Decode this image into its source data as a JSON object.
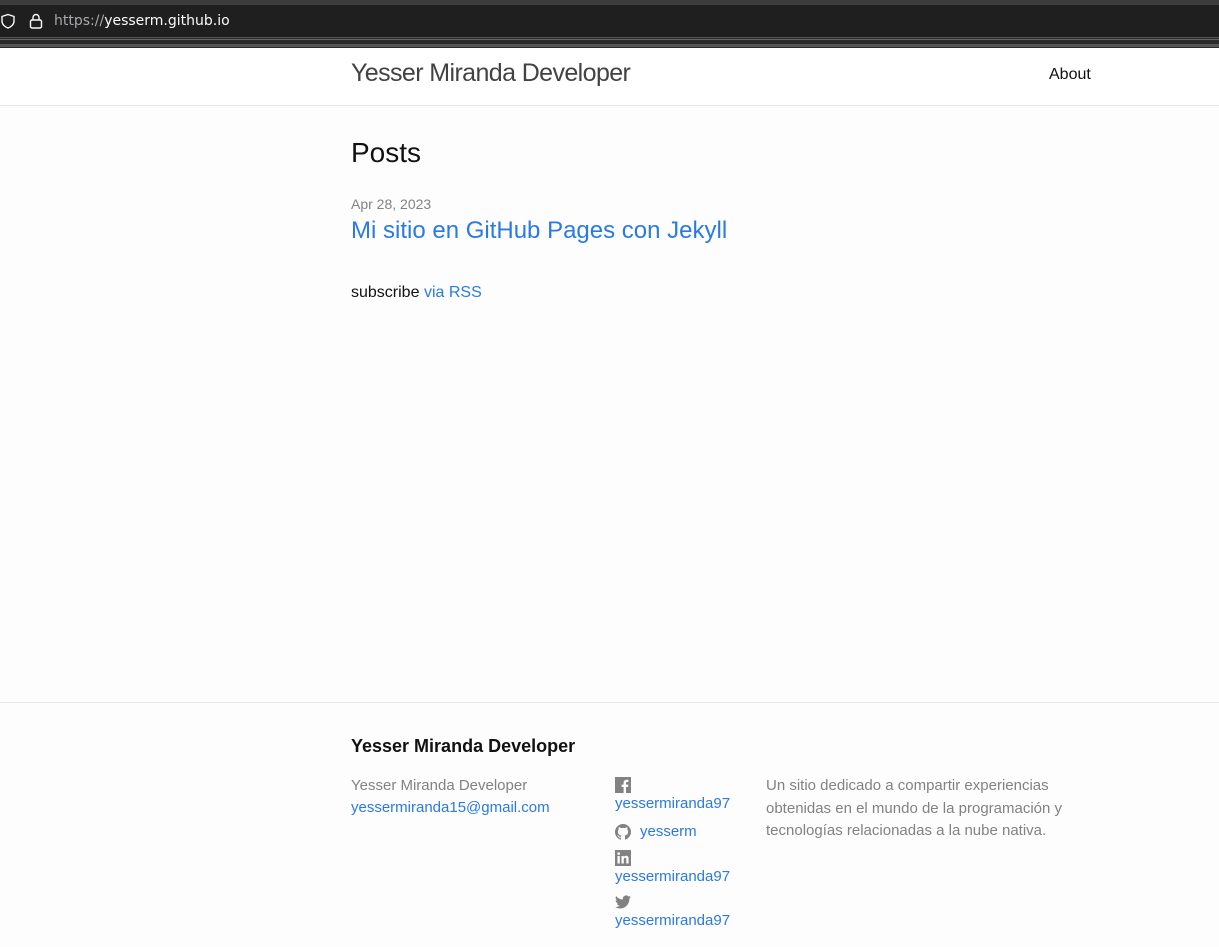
{
  "browser": {
    "url_scheme": "https://",
    "url_host": "yesserm.github.io"
  },
  "header": {
    "site_title": "Yesser Miranda Developer",
    "nav": [
      {
        "label": "About"
      }
    ]
  },
  "main": {
    "heading": "Posts",
    "posts": [
      {
        "date": "Apr 28, 2023",
        "title": "Mi sitio en GitHub Pages con Jekyll"
      }
    ],
    "subscribe_text": "subscribe",
    "rss_link": "via RSS"
  },
  "footer": {
    "heading": "Yesser Miranda Developer",
    "name": "Yesser Miranda Developer",
    "email": "yessermiranda15@gmail.com",
    "social": {
      "facebook": {
        "icon": "facebook-icon",
        "handle": "yessermiranda97"
      },
      "github": {
        "icon": "github-icon",
        "handle": "yesserm"
      },
      "linkedin": {
        "icon": "linkedin-icon",
        "handle": "yessermiranda97"
      },
      "twitter": {
        "icon": "twitter-icon",
        "handle": "yessermiranda97"
      }
    },
    "description": "Un sitio dedicado a compartir experiencias obtenidas en el mundo de la programación y tecnologías relacionadas a la nube nativa."
  },
  "colors": {
    "link": "#2a7ae2",
    "muted": "#828282",
    "text": "#111111"
  }
}
